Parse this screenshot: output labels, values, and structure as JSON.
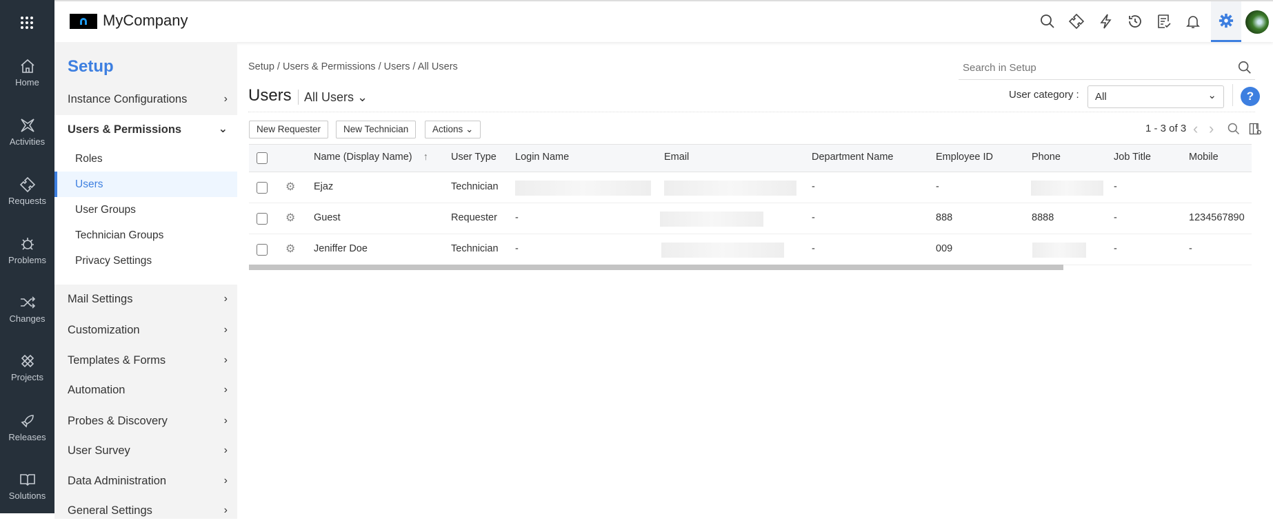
{
  "rail": {
    "items": [
      {
        "label": "Home",
        "icon": "home-icon"
      },
      {
        "label": "Activities",
        "icon": "activities-icon"
      },
      {
        "label": "Requests",
        "icon": "ticket-icon"
      },
      {
        "label": "Problems",
        "icon": "bug-icon"
      },
      {
        "label": "Changes",
        "icon": "shuffle-icon"
      },
      {
        "label": "Projects",
        "icon": "projects-icon"
      },
      {
        "label": "Releases",
        "icon": "rocket-icon"
      },
      {
        "label": "Solutions",
        "icon": "book-icon"
      }
    ]
  },
  "header": {
    "company": "MyCompany",
    "accent": "#3d7fe0"
  },
  "sidebar": {
    "title": "Setup",
    "sections": [
      {
        "label": "Instance Configurations"
      },
      {
        "label": "Users & Permissions",
        "sub": [
          "Roles",
          "Users",
          "User Groups",
          "Technician Groups",
          "Privacy Settings"
        ]
      },
      {
        "label": "Mail Settings"
      },
      {
        "label": "Customization"
      },
      {
        "label": "Templates & Forms"
      },
      {
        "label": "Automation"
      },
      {
        "label": "Probes & Discovery"
      },
      {
        "label": "User Survey"
      },
      {
        "label": "Data Administration"
      },
      {
        "label": "General Settings"
      }
    ]
  },
  "main": {
    "breadcrumb": "Setup / Users & Permissions / Users / All Users",
    "search_placeholder": "Search in Setup",
    "title": "Users",
    "view": "All Users",
    "category_label": "User category :",
    "category_value": "All",
    "help": "?",
    "buttons": {
      "new_requester": "New Requester",
      "new_technician": "New Technician",
      "actions": "Actions"
    },
    "pagination": "1 - 3 of 3"
  },
  "table": {
    "columns": [
      "Name (Display Name)",
      "User Type",
      "Login Name",
      "Email",
      "Department Name",
      "Employee ID",
      "Phone",
      "Job Title",
      "Mobile"
    ],
    "rows": [
      {
        "name": "Ejaz",
        "type": "Technician",
        "login": "",
        "email": "",
        "dept": "-",
        "empid": "-",
        "phone": "",
        "job": "-",
        "mobile": ""
      },
      {
        "name": "Guest",
        "type": "Requester",
        "login": "-",
        "email": "",
        "dept": "-",
        "empid": "888",
        "phone": "8888",
        "job": "-",
        "mobile": "1234567890"
      },
      {
        "name": "Jeniffer Doe",
        "type": "Technician",
        "login": "-",
        "email": "",
        "dept": "-",
        "empid": "009",
        "phone": "",
        "job": "-",
        "mobile": "-"
      }
    ]
  }
}
